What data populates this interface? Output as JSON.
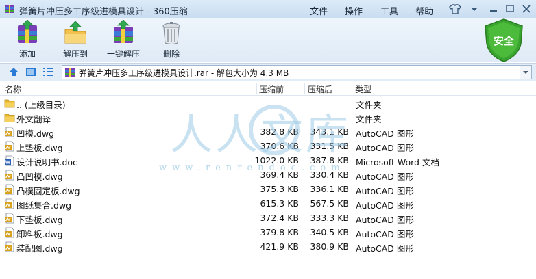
{
  "window": {
    "title": "弹簧片冲压多工序级进模具设计 - 360压缩",
    "menu": [
      "文件",
      "操作",
      "工具",
      "帮助"
    ]
  },
  "toolbar": {
    "add": "添加",
    "extract_to": "解压到",
    "one_click_extract": "一键解压",
    "delete": "删除"
  },
  "security_badge": "安全",
  "address_bar": {
    "path": "弹簧片冲压多工序级进模具设计.rar - 解包大小为 4.3 MB"
  },
  "columns": {
    "name": "名称",
    "size": "压缩前",
    "packed": "压缩后",
    "type": "类型"
  },
  "files": [
    {
      "name": ".. (上级目录)",
      "size": "",
      "packed": "",
      "type": "文件夹",
      "icon": "folder-icon"
    },
    {
      "name": "外文翻译",
      "size": "",
      "packed": "",
      "type": "文件夹",
      "icon": "folder-icon"
    },
    {
      "name": "凹模.dwg",
      "size": "382.8 KB",
      "packed": "343.1 KB",
      "type": "AutoCAD 图形",
      "icon": "dwg-file-icon"
    },
    {
      "name": "上垫板.dwg",
      "size": "370.6 KB",
      "packed": "331.5 KB",
      "type": "AutoCAD 图形",
      "icon": "dwg-file-icon"
    },
    {
      "name": "设计说明书.doc",
      "size": "1022.0 KB",
      "packed": "387.8 KB",
      "type": "Microsoft Word 文档",
      "icon": "doc-file-icon"
    },
    {
      "name": "凸凹模.dwg",
      "size": "369.4 KB",
      "packed": "330.4 KB",
      "type": "AutoCAD 图形",
      "icon": "dwg-file-icon"
    },
    {
      "name": "凸模固定板.dwg",
      "size": "375.3 KB",
      "packed": "336.1 KB",
      "type": "AutoCAD 图形",
      "icon": "dwg-file-icon"
    },
    {
      "name": "图纸集合.dwg",
      "size": "615.3 KB",
      "packed": "567.5 KB",
      "type": "AutoCAD 图形",
      "icon": "dwg-file-icon"
    },
    {
      "name": "下垫板.dwg",
      "size": "372.4 KB",
      "packed": "333.3 KB",
      "type": "AutoCAD 图形",
      "icon": "dwg-file-icon"
    },
    {
      "name": "卸料板.dwg",
      "size": "379.8 KB",
      "packed": "340.5 KB",
      "type": "AutoCAD 图形",
      "icon": "dwg-file-icon"
    },
    {
      "name": "装配图.dwg",
      "size": "421.9 KB",
      "packed": "380.9 KB",
      "type": "AutoCAD 图形",
      "icon": "dwg-file-icon"
    }
  ],
  "watermark": {
    "text": "人人文库",
    "url": "www.renrendoc.com"
  },
  "colors": {
    "title_bg": "#c9ddf1",
    "accent": "#2b7bd6",
    "shield": "#3aa52e",
    "folder": "#e8b730",
    "dwg": "#d7a21e",
    "watermark": "#9ecbe6"
  }
}
